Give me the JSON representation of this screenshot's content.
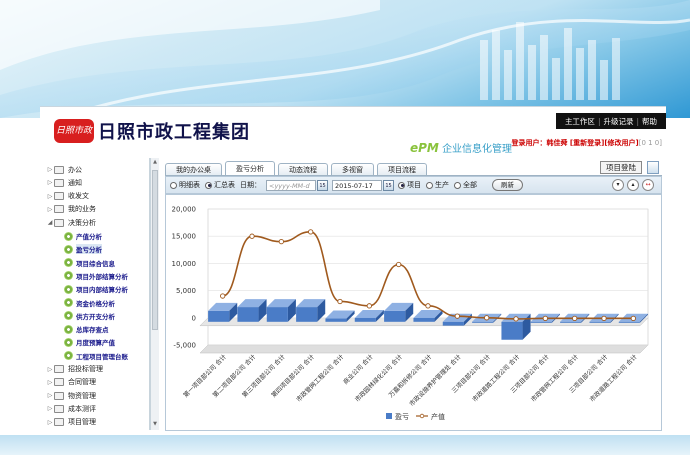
{
  "header": {
    "logo_text": "日照市政",
    "company_name": "日照市政工程集团",
    "product_e": "ePM",
    "product_name": "企业信息化管理",
    "links": [
      "主工作区",
      "升级记录",
      "帮助"
    ],
    "user_label": "登录用户：",
    "user_name": "韩佳舜",
    "reset_pwd": "[重新登录]",
    "change_user": "[修改用户]",
    "extra": "[0 1 0]"
  },
  "sidebar": {
    "items": [
      {
        "label": "办公",
        "level": 0,
        "expanded": false
      },
      {
        "label": "通知",
        "level": 0,
        "expanded": false
      },
      {
        "label": "收发文",
        "level": 0,
        "expanded": false
      },
      {
        "label": "我的业务",
        "level": 0,
        "expanded": false
      },
      {
        "label": "决策分析",
        "level": 0,
        "expanded": true
      },
      {
        "label": "产值分析",
        "level": 1
      },
      {
        "label": "盈亏分析",
        "level": 1,
        "selected": true
      },
      {
        "label": "项目综合信息",
        "level": 1
      },
      {
        "label": "项目外部结算分析",
        "level": 1
      },
      {
        "label": "项目内部结算分析",
        "level": 1
      },
      {
        "label": "资金价格分析",
        "level": 1
      },
      {
        "label": "供方开支分析",
        "level": 1
      },
      {
        "label": "总库存查点",
        "level": 1
      },
      {
        "label": "月度预算产值",
        "level": 1
      },
      {
        "label": "工程项目管理台账",
        "level": 1
      },
      {
        "label": "招投标管理",
        "level": 0,
        "expanded": false
      },
      {
        "label": "合同管理",
        "level": 0,
        "expanded": false
      },
      {
        "label": "物资管理",
        "level": 0,
        "expanded": false
      },
      {
        "label": "成本测评",
        "level": 0,
        "expanded": false
      },
      {
        "label": "项目管理",
        "level": 0,
        "expanded": false
      }
    ]
  },
  "tabs": [
    {
      "label": "我的办公桌",
      "active": false
    },
    {
      "label": "盈亏分析",
      "active": true
    },
    {
      "label": "动态流程",
      "active": false
    },
    {
      "label": "多视窗",
      "active": false
    },
    {
      "label": "项目流程",
      "active": false
    }
  ],
  "project_login": "项目登陆",
  "filter": {
    "opt_detail": "明细表",
    "opt_summary": "汇总表",
    "date_label": "日期：",
    "date_from_placeholder": "<yyyy-MM-d",
    "date_to": "2015-07-17",
    "opt_project": "项目",
    "opt_production": "生产",
    "opt_all": "全部",
    "refresh": "刷新",
    "selected_mode": "汇总表",
    "selected_scope": "项目"
  },
  "colors": {
    "bar": "#4a7cc7",
    "line": "#a05a1e",
    "marker": "#ffffff"
  },
  "chart_data": {
    "type": "bar",
    "title": "",
    "ylim": [
      -5000,
      20000
    ],
    "yticks": [
      "20,000",
      "15,000",
      "10,000",
      "5,000",
      "0",
      "-5,000"
    ],
    "yvalues": [
      20000,
      15000,
      10000,
      5000,
      0,
      -5000
    ],
    "categories": [
      "第一项目部公司 合计",
      "第二项目部公司 合计",
      "第三项目部公司 合计",
      "第四项目部公司 合计",
      "市政管网工程公司 合计",
      "商业公司 合计",
      "市政园林绿化公司 合计",
      "万嘉和拆修公司 合计",
      "市政设施养护管理处 合计",
      "三项目部公司 合计",
      "市政道路工程公司 合计",
      "三项目部公司 合计",
      "市政管网工程公司 合计",
      "三项目部公司 合计",
      "市政道路工程公司 合计"
    ],
    "series": [
      {
        "name": "盈亏",
        "type": "bar",
        "values": [
          2000,
          2700,
          2700,
          2700,
          600,
          700,
          2000,
          700,
          -700,
          -100,
          -3300,
          -100,
          -100,
          -100,
          -100
        ]
      },
      {
        "name": "产值",
        "type": "line",
        "values": [
          4000,
          15000,
          14000,
          15800,
          3000,
          2200,
          9800,
          2200,
          300,
          0,
          -200,
          -100,
          -100,
          -100,
          -100
        ]
      }
    ],
    "legend": "bottom-center"
  }
}
